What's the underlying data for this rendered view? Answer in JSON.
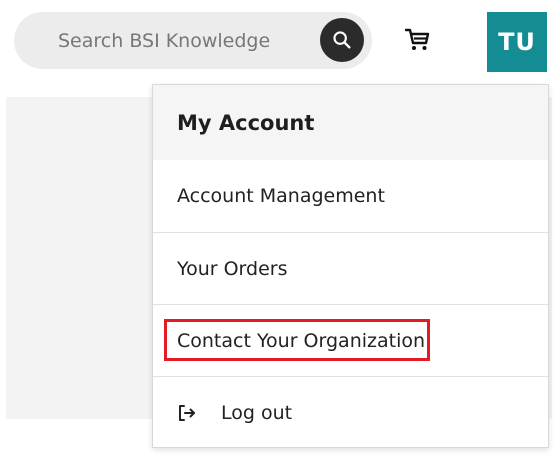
{
  "header": {
    "search": {
      "placeholder": "Search BSI Knowledge",
      "value": "",
      "button_icon": "search-icon"
    },
    "cart": {
      "icon": "cart-icon"
    },
    "avatar": {
      "initials": "TU",
      "background": "#138c94"
    }
  },
  "account_menu": {
    "title": "My Account",
    "items": [
      {
        "label": "Account Management"
      },
      {
        "label": "Your Orders"
      },
      {
        "label": "Contact Your Organization",
        "highlighted": true,
        "highlight_color": "#e31b23"
      },
      {
        "label": "Log out",
        "icon": "logout-icon"
      }
    ]
  },
  "colors": {
    "accent": "#138c94",
    "highlight": "#e31b23"
  }
}
